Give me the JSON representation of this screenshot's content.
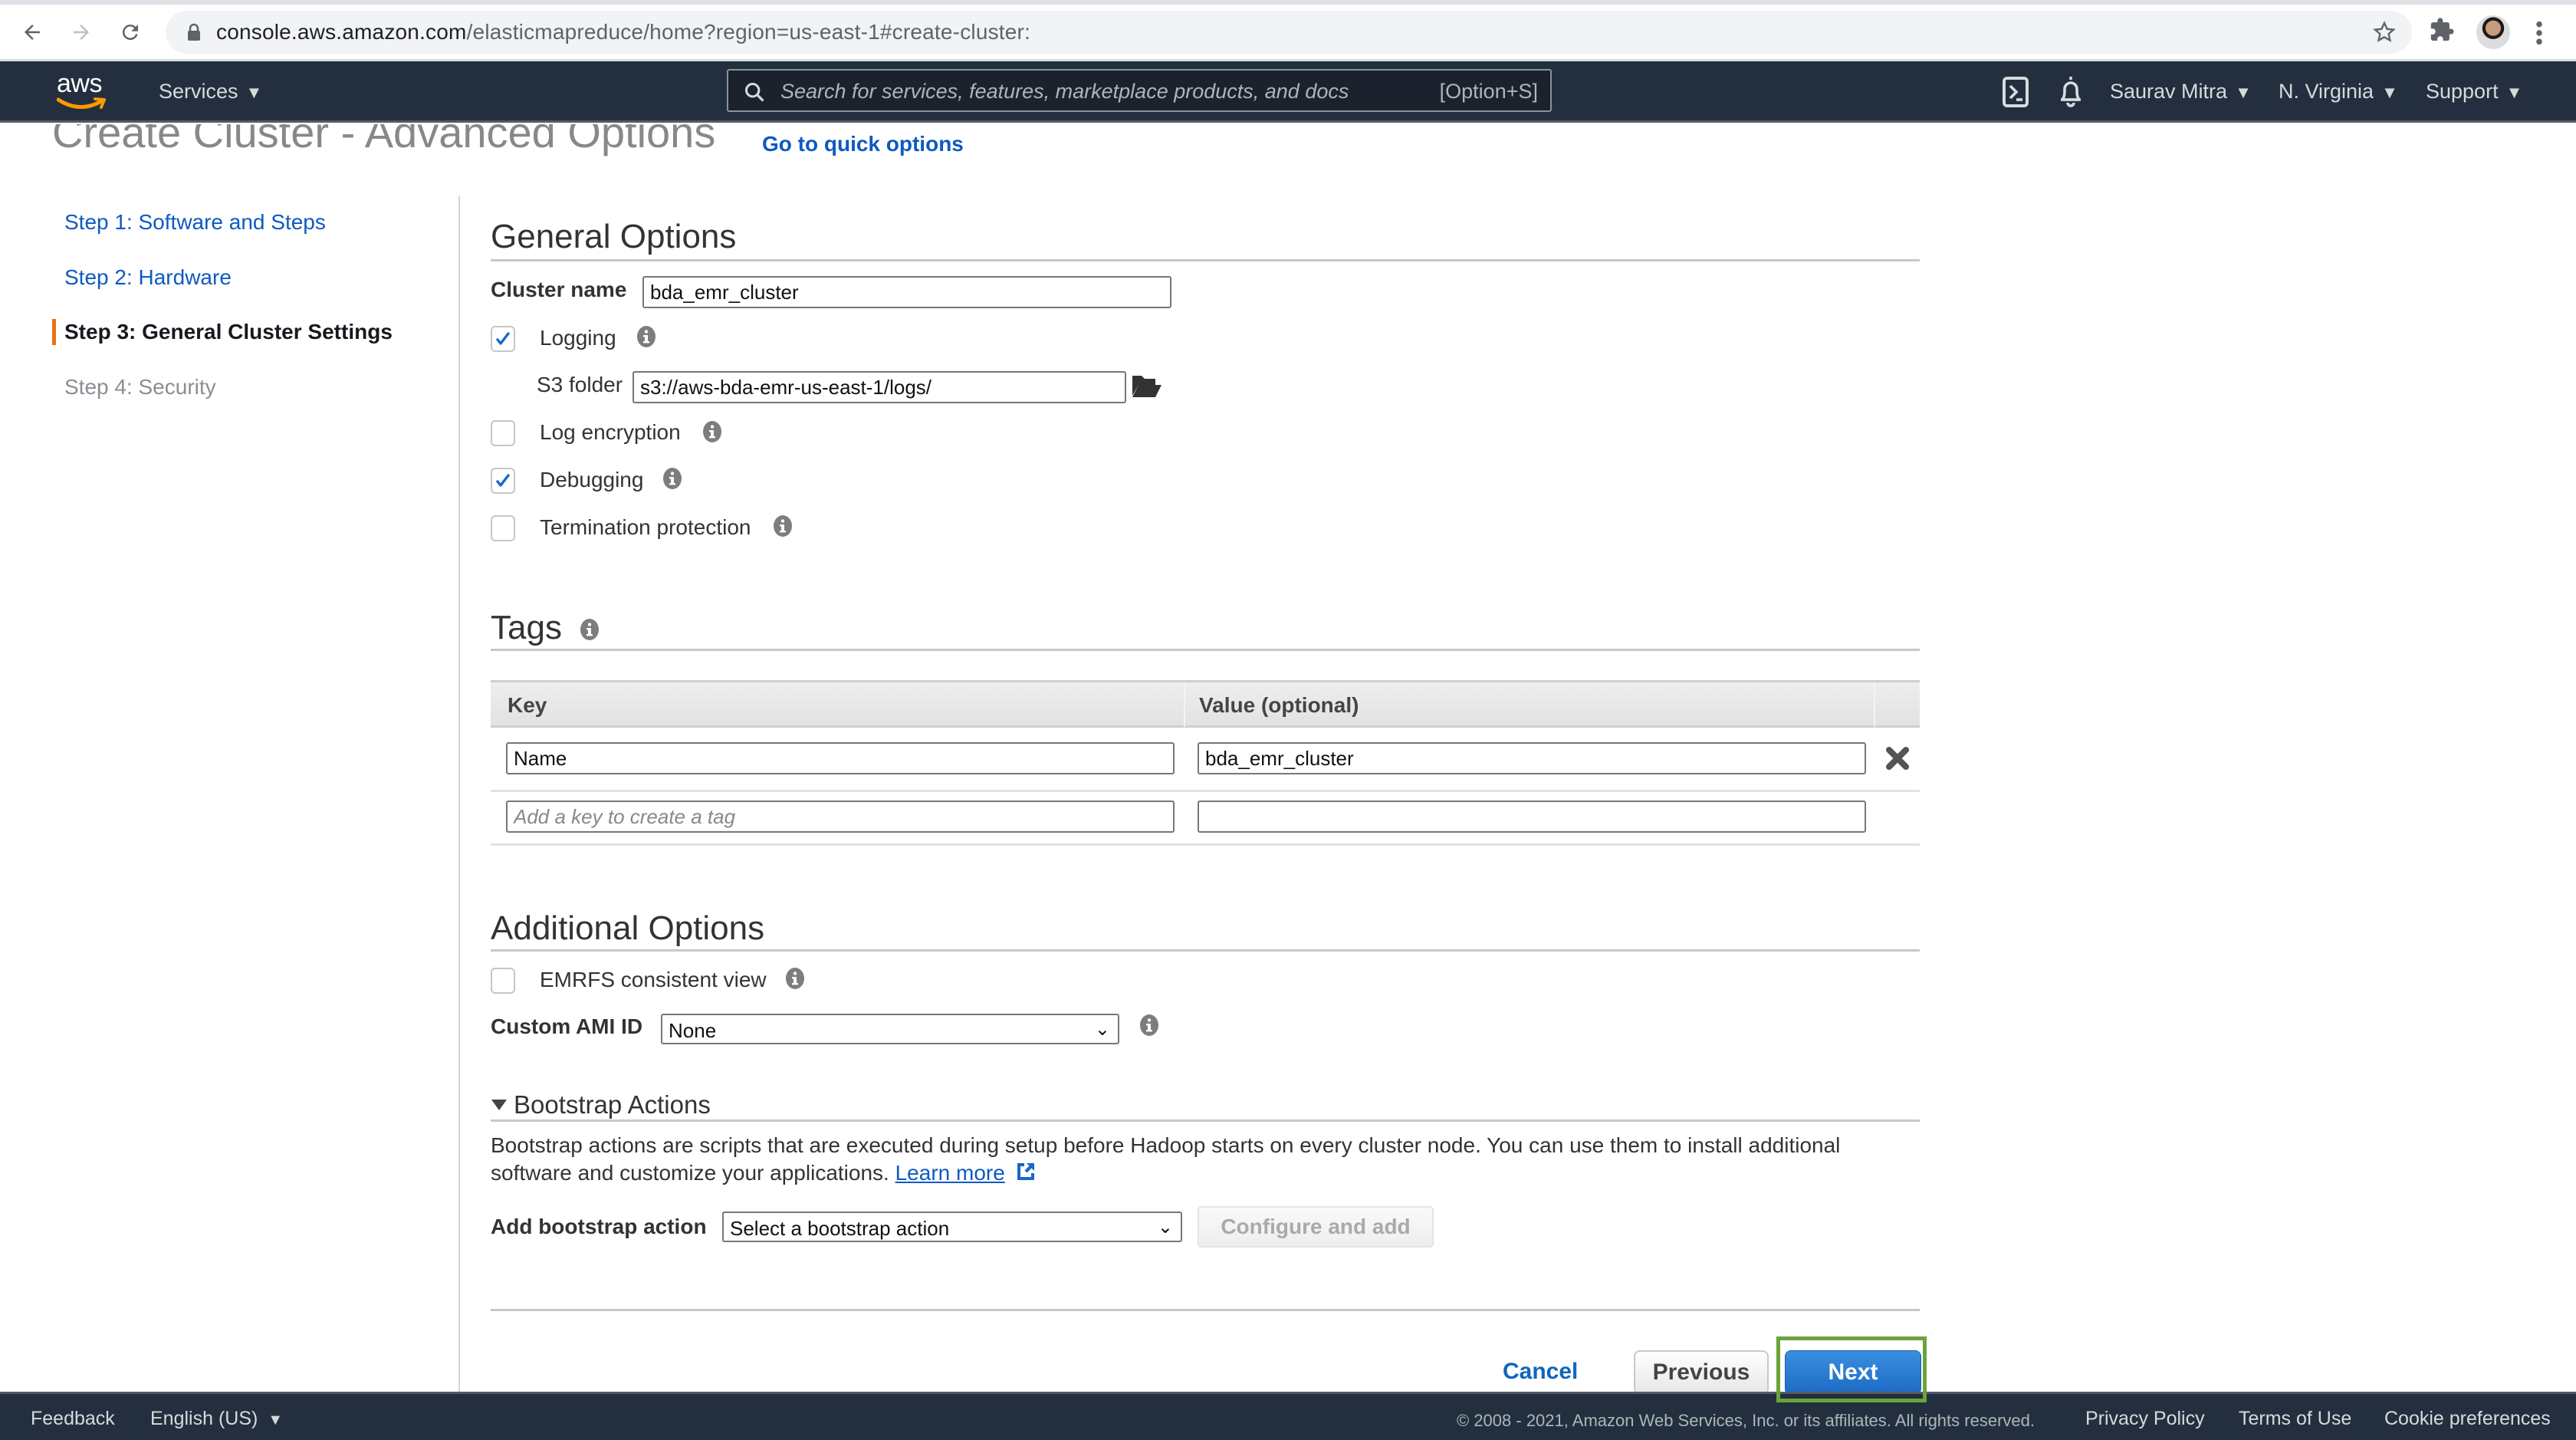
{
  "browser": {
    "url_host": "console.aws.amazon.com",
    "url_path": "/elasticmapreduce/home?region=us-east-1#create-cluster:",
    "icons": [
      "back-arrow-icon",
      "forward-arrow-icon",
      "reload-icon",
      "lock-icon",
      "bookmark-star-icon",
      "extensions-puzzle-icon",
      "profile-avatar",
      "kebab-menu-icon"
    ]
  },
  "awsnav": {
    "logo_text": "aws",
    "services_label": "Services",
    "search_placeholder": "Search for services, features, marketplace products, and docs",
    "search_shortcut": "[Option+S]",
    "user_label": "Saurav Mitra",
    "region_label": "N. Virginia",
    "support_label": "Support",
    "caret": "▼"
  },
  "page": {
    "title": "Create Cluster - Advanced Options",
    "quick_options_link": "Go to quick options"
  },
  "steps": [
    {
      "label": "Step 1: Software and Steps",
      "state": "link"
    },
    {
      "label": "Step 2: Hardware",
      "state": "link"
    },
    {
      "label": "Step 3: General Cluster Settings",
      "state": "active"
    },
    {
      "label": "Step 4: Security",
      "state": "disabled"
    }
  ],
  "general_options": {
    "heading": "General Options",
    "cluster_name_label": "Cluster name",
    "cluster_name_value": "bda_emr_cluster",
    "logging_label": "Logging",
    "logging_checked": true,
    "s3_folder_label": "S3 folder",
    "s3_folder_value": "s3://aws-bda-emr-us-east-1/logs/",
    "log_encryption_label": "Log encryption",
    "log_encryption_checked": false,
    "debugging_label": "Debugging",
    "debugging_checked": true,
    "termination_protection_label": "Termination protection",
    "termination_protection_checked": false
  },
  "tags": {
    "heading": "Tags",
    "columns": [
      "Key",
      "Value (optional)"
    ],
    "rows": [
      {
        "key": "Name",
        "value": "bda_emr_cluster"
      }
    ],
    "new_key_placeholder": "Add a key to create a tag",
    "new_value": ""
  },
  "additional_options": {
    "heading": "Additional Options",
    "emrfs_label": "EMRFS consistent view",
    "emrfs_checked": false,
    "custom_ami_label": "Custom AMI ID",
    "custom_ami_value": "None"
  },
  "bootstrap": {
    "heading": "Bootstrap Actions",
    "description": "Bootstrap actions are scripts that are executed during setup before Hadoop starts on every cluster node. You can use them to install additional software and customize your applications.",
    "learn_more": "Learn more",
    "add_label": "Add bootstrap action",
    "select_value": "Select a bootstrap action",
    "configure_button": "Configure and add"
  },
  "actions": {
    "cancel": "Cancel",
    "previous": "Previous",
    "next": "Next",
    "highlight_color": "#6aa43a"
  },
  "footer": {
    "feedback": "Feedback",
    "language": "English (US)",
    "copyright": "© 2008 - 2021, Amazon Web Services, Inc. or its affiliates. All rights reserved.",
    "privacy": "Privacy Policy",
    "terms": "Terms of Use",
    "cookies": "Cookie preferences"
  },
  "colors": {
    "nav_bg": "#232f3e",
    "link_blue": "#0e5ac0",
    "step_marker": "#ec7211",
    "primary_button": "#1e6bc5",
    "checkbox_check": "#1a66c9"
  }
}
